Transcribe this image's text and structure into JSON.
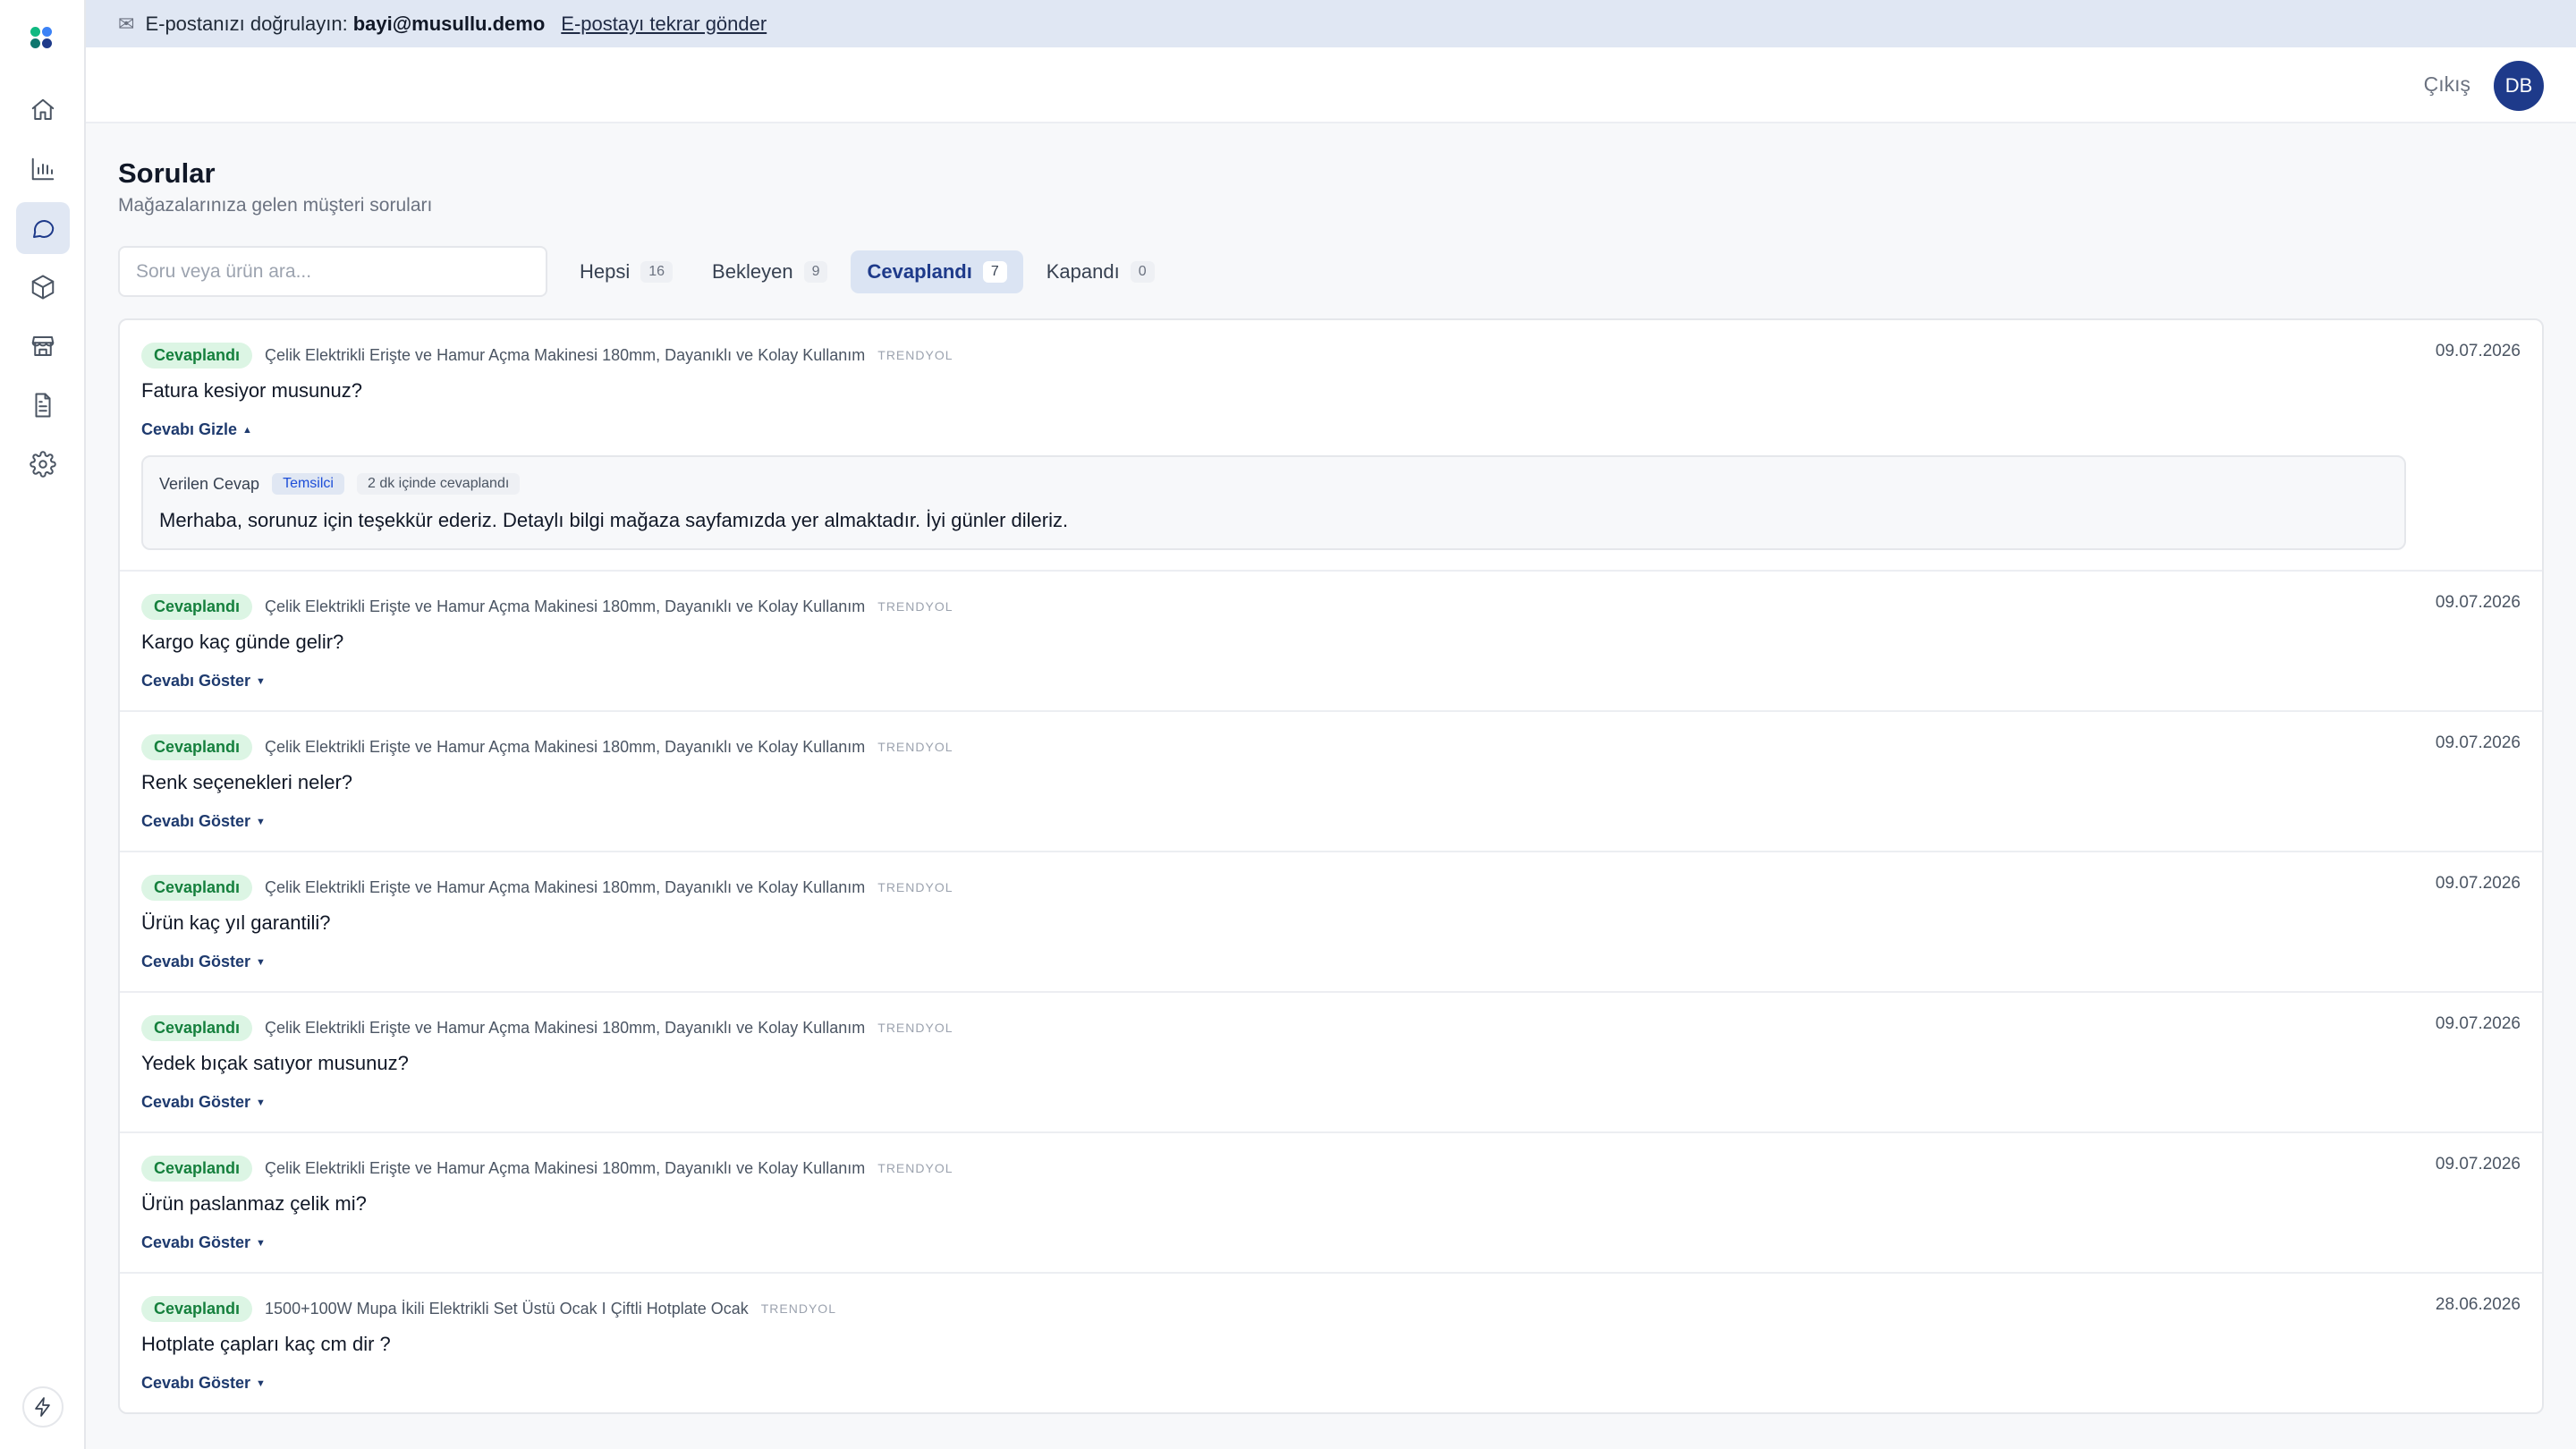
{
  "banner": {
    "prefix": "E-postanızı doğrulayın:",
    "email": "bayi@musullu.demo",
    "resend_label": "E-postayı tekrar gönder"
  },
  "header": {
    "logout_label": "Çıkış",
    "avatar_initials": "DB"
  },
  "sidebar": {
    "items": [
      {
        "icon": "home-icon",
        "active": false
      },
      {
        "icon": "bar-chart-icon",
        "active": false
      },
      {
        "icon": "message-icon",
        "active": true
      },
      {
        "icon": "box-icon",
        "active": false
      },
      {
        "icon": "store-icon",
        "active": false
      },
      {
        "icon": "document-icon",
        "active": false
      },
      {
        "icon": "gear-icon",
        "active": false
      }
    ],
    "bottom_icon": "bolt-icon"
  },
  "page": {
    "title": "Sorular",
    "subtitle": "Mağazalarınıza gelen müşteri soruları"
  },
  "search": {
    "placeholder": "Soru veya ürün ara..."
  },
  "tabs": [
    {
      "label": "Hepsi",
      "count": "16"
    },
    {
      "label": "Bekleyen",
      "count": "9"
    },
    {
      "label": "Cevaplandı",
      "count": "7",
      "active": true
    },
    {
      "label": "Kapandı",
      "count": "0"
    }
  ],
  "questions": [
    {
      "status": "Cevaplandı",
      "product": "Çelik Elektrikli Erişte ve Hamur Açma Makinesi 180mm, Dayanıklı ve Kolay Kullanım",
      "platform": "TRENDYOL",
      "date": "09.07.2026",
      "question": "Fatura kesiyor musunuz?",
      "toggle_label": "Cevabı Gizle",
      "expanded": true,
      "answer": {
        "title": "Verilen Cevap",
        "role": "Temsilci",
        "response_time": "2 dk içinde cevaplandı",
        "text": "Merhaba, sorunuz için teşekkür ederiz. Detaylı bilgi mağaza sayfamızda yer almaktadır. İyi günler dileriz."
      }
    },
    {
      "status": "Cevaplandı",
      "product": "Çelik Elektrikli Erişte ve Hamur Açma Makinesi 180mm, Dayanıklı ve Kolay Kullanım",
      "platform": "TRENDYOL",
      "date": "09.07.2026",
      "question": "Kargo kaç günde gelir?",
      "toggle_label": "Cevabı Göster",
      "expanded": false
    },
    {
      "status": "Cevaplandı",
      "product": "Çelik Elektrikli Erişte ve Hamur Açma Makinesi 180mm, Dayanıklı ve Kolay Kullanım",
      "platform": "TRENDYOL",
      "date": "09.07.2026",
      "question": "Renk seçenekleri neler?",
      "toggle_label": "Cevabı Göster",
      "expanded": false
    },
    {
      "status": "Cevaplandı",
      "product": "Çelik Elektrikli Erişte ve Hamur Açma Makinesi 180mm, Dayanıklı ve Kolay Kullanım",
      "platform": "TRENDYOL",
      "date": "09.07.2026",
      "question": "Ürün kaç yıl garantili?",
      "toggle_label": "Cevabı Göster",
      "expanded": false
    },
    {
      "status": "Cevaplandı",
      "product": "Çelik Elektrikli Erişte ve Hamur Açma Makinesi 180mm, Dayanıklı ve Kolay Kullanım",
      "platform": "TRENDYOL",
      "date": "09.07.2026",
      "question": "Yedek bıçak satıyor musunuz?",
      "toggle_label": "Cevabı Göster",
      "expanded": false
    },
    {
      "status": "Cevaplandı",
      "product": "Çelik Elektrikli Erişte ve Hamur Açma Makinesi 180mm, Dayanıklı ve Kolay Kullanım",
      "platform": "TRENDYOL",
      "date": "09.07.2026",
      "question": "Ürün paslanmaz çelik mi?",
      "toggle_label": "Cevabı Göster",
      "expanded": false
    },
    {
      "status": "Cevaplandı",
      "product": "1500+100W Mupa İkili Elektrikli Set Üstü Ocak I Çiftli Hotplate Ocak",
      "platform": "TRENDYOL",
      "date": "28.06.2026",
      "question": "Hotplate çapları kaç cm dir ?",
      "toggle_label": "Cevabı Göster",
      "expanded": false
    }
  ]
}
